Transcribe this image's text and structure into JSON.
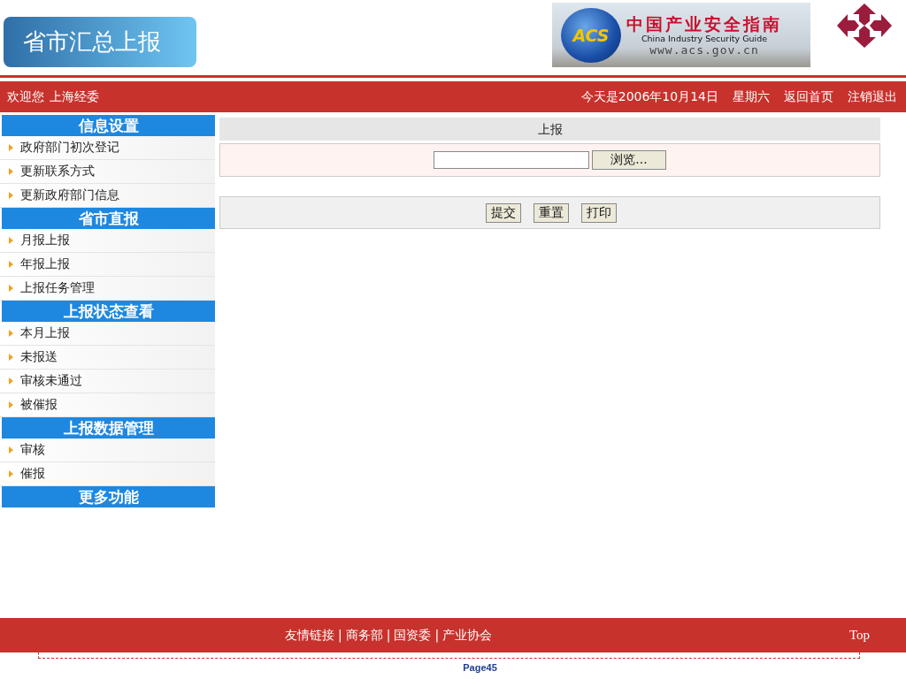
{
  "slide_title": "省市汇总上报",
  "banner": {
    "globe_text": "ACS",
    "title": "中国产业安全指南",
    "subtitle": "China Industry Security Guide",
    "url": "www.acs.gov.cn"
  },
  "top_bar": {
    "welcome": "欢迎您",
    "user": "上海经委",
    "date": "今天是2006年10月14日",
    "weekday": "星期六",
    "links": [
      "返回首页",
      "注销退出"
    ]
  },
  "sidebar": [
    {
      "title": "信息设置",
      "items": [
        "政府部门初次登记",
        "更新联系方式",
        "更新政府部门信息"
      ]
    },
    {
      "title": "省市直报",
      "items": [
        "月报上报",
        "年报上报",
        "上报任务管理"
      ]
    },
    {
      "title": "上报状态查看",
      "items": [
        "本月上报",
        "未报送",
        "审核未通过",
        "被催报"
      ]
    },
    {
      "title": "上报数据管理",
      "items": [
        "审核",
        "催报"
      ]
    },
    {
      "title": "更多功能"
    }
  ],
  "form": {
    "heading": "上报",
    "browse_button": "浏览...",
    "buttons": [
      "提交",
      "重置",
      "打印"
    ]
  },
  "footer": {
    "links": [
      "友情链接",
      "商务部",
      "国资委",
      "产业协会"
    ],
    "separator": "|",
    "top_link": "Top"
  },
  "page_number": "Page45"
}
